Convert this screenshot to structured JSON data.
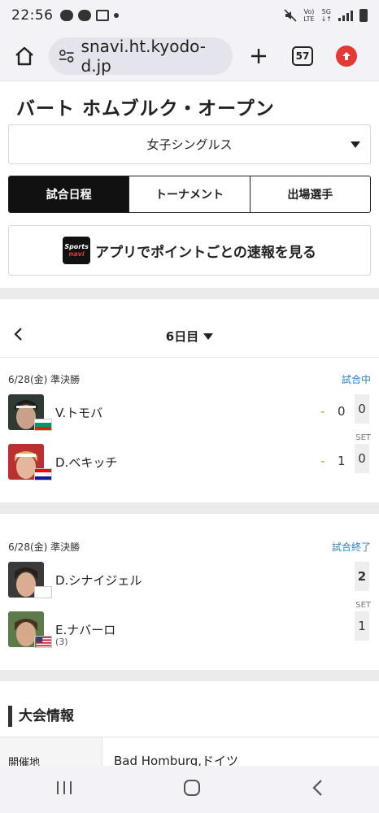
{
  "status_bar": {
    "time": "22:56",
    "net_label_top": "Vo)",
    "net_label_bottom": "LTE",
    "net2_top": "5G",
    "net2_bottom": "↓↑"
  },
  "browser": {
    "url": "snavi.ht.kyodo-d.jp",
    "tab_count": "57"
  },
  "page": {
    "title": "バート ホムブルク・オープン",
    "event_select": "女子シングルス",
    "tabs": [
      "試合日程",
      "トーナメント",
      "出場選手"
    ],
    "app_banner": "アプリでポイントごとの速報を見る",
    "app_logo_top": "Sports",
    "app_logo_bottom": "navi",
    "day_label": "6日目"
  },
  "matches": [
    {
      "date_round": "6/28(金) 準決勝",
      "status": "試合中",
      "set_label": "SET",
      "players": [
        {
          "name": "V.トモバ",
          "dash": "-",
          "game": "0",
          "sets": "0"
        },
        {
          "name": "D.ベキッチ",
          "dash": "-",
          "game": "1",
          "sets": "0"
        }
      ]
    },
    {
      "date_round": "6/28(金) 準決勝",
      "status": "試合終了",
      "set_label": "SET",
      "players": [
        {
          "name": "D.シナイジェル",
          "seed": "",
          "sets": "2"
        },
        {
          "name": "E.ナバーロ",
          "seed": "(3)",
          "sets": "1"
        }
      ]
    }
  ],
  "info": {
    "title": "大会情報",
    "venue_key": "開催地",
    "venue_value": "Bad Homburg,ドイツ"
  },
  "colors": {
    "status_blue": "#2f7fc8",
    "dash_green": "#8bb32b",
    "update_red": "#e53935"
  }
}
